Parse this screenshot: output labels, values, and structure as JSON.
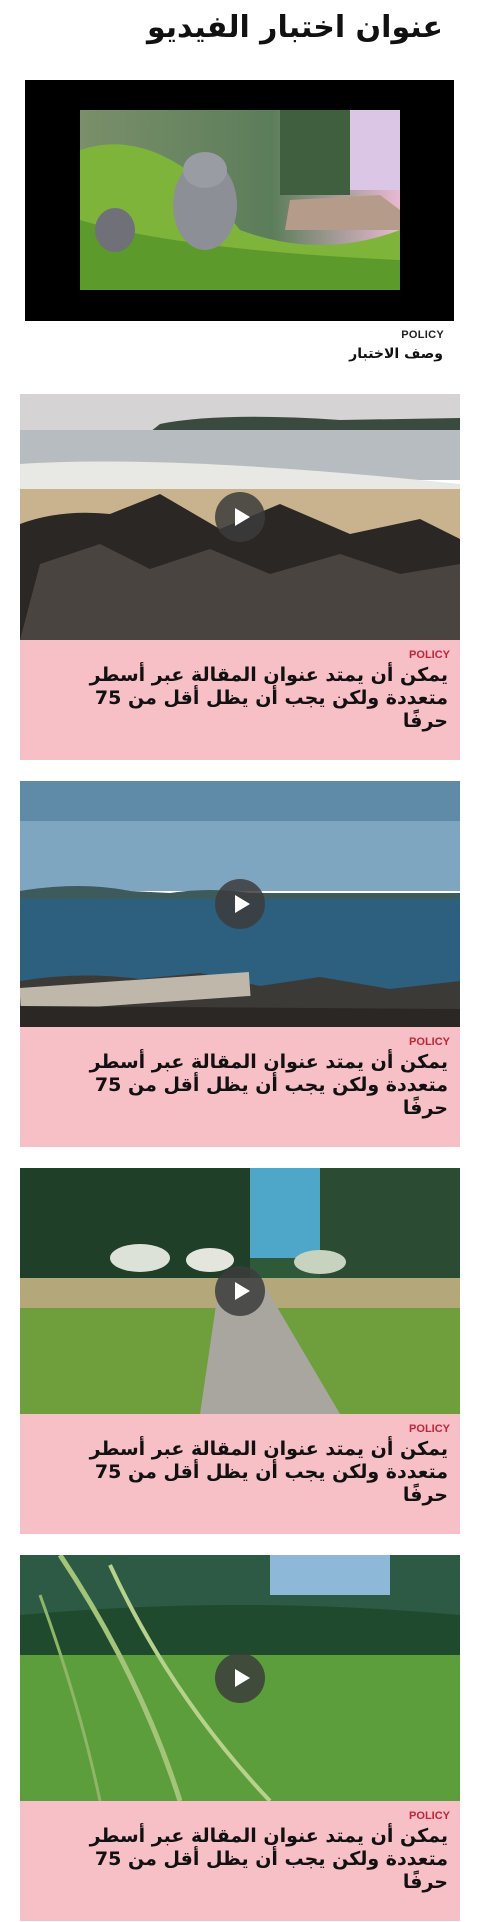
{
  "page": {
    "title": "عنوان اختبار الفيديو"
  },
  "featured": {
    "category": "POLICY",
    "description": "وصف الاختبار"
  },
  "cards": [
    {
      "category": "POLICY",
      "title": "يمكن أن يمتد عنوان المقالة عبر أسطر متعددة ولكن يجب أن يظل أقل من 75 حرفًا",
      "image": "beach-rocks"
    },
    {
      "category": "POLICY",
      "title": "يمكن أن يمتد عنوان المقالة عبر أسطر متعددة ولكن يجب أن يظل أقل من 75 حرفًا",
      "image": "sea-shore"
    },
    {
      "category": "POLICY",
      "title": "يمكن أن يمتد عنوان المقالة عبر أسطر متعددة ولكن يجب أن يظل أقل من 75 حرفًا",
      "image": "forest-path"
    },
    {
      "category": "POLICY",
      "title": "يمكن أن يمتد عنوان المقالة عبر أسطر متعددة ولكن يجب أن يظل أقل من 75 حرفًا",
      "image": "grass-field"
    }
  ],
  "icons": {
    "play": "play-icon"
  },
  "colors": {
    "card_background": "#f7bfc6",
    "category_accent": "#c0263a",
    "video_background": "#000000"
  }
}
